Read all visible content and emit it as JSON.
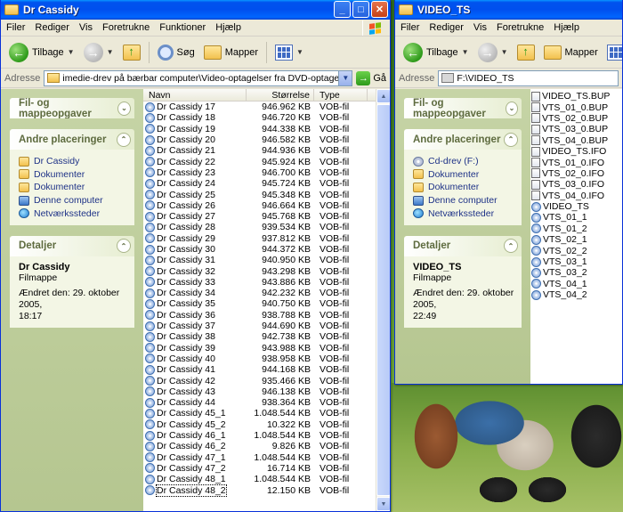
{
  "window1": {
    "title": "Dr Cassidy",
    "menu": [
      "Filer",
      "Rediger",
      "Vis",
      "Foretrukne",
      "Funktioner",
      "Hjælp"
    ],
    "toolbar": {
      "back": "Tilbage",
      "search": "Søg",
      "folders": "Mapper"
    },
    "address": {
      "label": "Adresse",
      "path": "imedie-drev på bærbar computer\\Video-optagelser fra DVD-optagere\\Dr Cassidy\\Dr Cassidy",
      "go": "Gå"
    },
    "tasks": {
      "file_tasks": "Fil- og mappeopgaver",
      "other_places": "Andre placeringer",
      "other_items": [
        "Dr Cassidy",
        "Dokumenter",
        "Dokumenter",
        "Denne computer",
        "Netværkssteder"
      ],
      "details": "Detaljer",
      "detail_name": "Dr Cassidy",
      "detail_type": "Filmappe",
      "detail_modified_1": "Ændret den: 29. oktober 2005,",
      "detail_modified_2": "18:17"
    },
    "columns": {
      "name": "Navn",
      "size": "Størrelse",
      "type": "Type"
    },
    "files": [
      {
        "name": "Dr Cassidy 17",
        "size": "946.962 KB",
        "type": "VOB-fil"
      },
      {
        "name": "Dr Cassidy 18",
        "size": "946.720 KB",
        "type": "VOB-fil"
      },
      {
        "name": "Dr Cassidy 19",
        "size": "944.338 KB",
        "type": "VOB-fil"
      },
      {
        "name": "Dr Cassidy 20",
        "size": "946.582 KB",
        "type": "VOB-fil"
      },
      {
        "name": "Dr Cassidy 21",
        "size": "944.936 KB",
        "type": "VOB-fil"
      },
      {
        "name": "Dr Cassidy 22",
        "size": "945.924 KB",
        "type": "VOB-fil"
      },
      {
        "name": "Dr Cassidy 23",
        "size": "946.700 KB",
        "type": "VOB-fil"
      },
      {
        "name": "Dr Cassidy 24",
        "size": "945.724 KB",
        "type": "VOB-fil"
      },
      {
        "name": "Dr Cassidy 25",
        "size": "945.348 KB",
        "type": "VOB-fil"
      },
      {
        "name": "Dr Cassidy 26",
        "size": "946.664 KB",
        "type": "VOB-fil"
      },
      {
        "name": "Dr Cassidy 27",
        "size": "945.768 KB",
        "type": "VOB-fil"
      },
      {
        "name": "Dr Cassidy 28",
        "size": "939.534 KB",
        "type": "VOB-fil"
      },
      {
        "name": "Dr Cassidy 29",
        "size": "937.812 KB",
        "type": "VOB-fil"
      },
      {
        "name": "Dr Cassidy 30",
        "size": "944.372 KB",
        "type": "VOB-fil"
      },
      {
        "name": "Dr Cassidy 31",
        "size": "940.950 KB",
        "type": "VOB-fil"
      },
      {
        "name": "Dr Cassidy 32",
        "size": "943.298 KB",
        "type": "VOB-fil"
      },
      {
        "name": "Dr Cassidy 33",
        "size": "943.886 KB",
        "type": "VOB-fil"
      },
      {
        "name": "Dr Cassidy 34",
        "size": "942.232 KB",
        "type": "VOB-fil"
      },
      {
        "name": "Dr Cassidy 35",
        "size": "940.750 KB",
        "type": "VOB-fil"
      },
      {
        "name": "Dr Cassidy 36",
        "size": "938.788 KB",
        "type": "VOB-fil"
      },
      {
        "name": "Dr Cassidy 37",
        "size": "944.690 KB",
        "type": "VOB-fil"
      },
      {
        "name": "Dr Cassidy 38",
        "size": "942.738 KB",
        "type": "VOB-fil"
      },
      {
        "name": "Dr Cassidy 39",
        "size": "943.988 KB",
        "type": "VOB-fil"
      },
      {
        "name": "Dr Cassidy 40",
        "size": "938.958 KB",
        "type": "VOB-fil"
      },
      {
        "name": "Dr Cassidy 41",
        "size": "944.168 KB",
        "type": "VOB-fil"
      },
      {
        "name": "Dr Cassidy 42",
        "size": "935.466 KB",
        "type": "VOB-fil"
      },
      {
        "name": "Dr Cassidy 43",
        "size": "946.138 KB",
        "type": "VOB-fil"
      },
      {
        "name": "Dr Cassidy 44",
        "size": "938.364 KB",
        "type": "VOB-fil"
      },
      {
        "name": "Dr Cassidy 45_1",
        "size": "1.048.544 KB",
        "type": "VOB-fil"
      },
      {
        "name": "Dr Cassidy 45_2",
        "size": "10.322 KB",
        "type": "VOB-fil"
      },
      {
        "name": "Dr Cassidy 46_1",
        "size": "1.048.544 KB",
        "type": "VOB-fil"
      },
      {
        "name": "Dr Cassidy 46_2",
        "size": "9.826 KB",
        "type": "VOB-fil"
      },
      {
        "name": "Dr Cassidy 47_1",
        "size": "1.048.544 KB",
        "type": "VOB-fil"
      },
      {
        "name": "Dr Cassidy 47_2",
        "size": "16.714 KB",
        "type": "VOB-fil"
      },
      {
        "name": "Dr Cassidy 48_1",
        "size": "1.048.544 KB",
        "type": "VOB-fil"
      },
      {
        "name": "Dr Cassidy 48_2",
        "size": "12.150 KB",
        "type": "VOB-fil"
      }
    ]
  },
  "window2": {
    "title": "VIDEO_TS",
    "menu": [
      "Filer",
      "Rediger",
      "Vis",
      "Foretrukne",
      "Hjælp"
    ],
    "toolbar": {
      "back": "Tilbage",
      "folders": "Mapper"
    },
    "address": {
      "label": "Adresse",
      "path": "F:\\VIDEO_TS"
    },
    "tasks": {
      "file_tasks": "Fil- og mappeopgaver",
      "other_places": "Andre placeringer",
      "other_items": [
        "Cd-drev (F:)",
        "Dokumenter",
        "Dokumenter",
        "Denne computer",
        "Netværkssteder"
      ],
      "details": "Detaljer",
      "detail_name": "VIDEO_TS",
      "detail_type": "Filmappe",
      "detail_modified_1": "Ændret den: 29. oktober 2005,",
      "detail_modified_2": "22:49"
    },
    "files": [
      "VIDEO_TS.BUP",
      "VTS_01_0.BUP",
      "VTS_02_0.BUP",
      "VTS_03_0.BUP",
      "VTS_04_0.BUP",
      "VIDEO_TS.IFO",
      "VTS_01_0.IFO",
      "VTS_02_0.IFO",
      "VTS_03_0.IFO",
      "VTS_04_0.IFO",
      "VIDEO_TS",
      "VTS_01_1",
      "VTS_01_2",
      "VTS_02_1",
      "VTS_02_2",
      "VTS_03_1",
      "VTS_03_2",
      "VTS_04_1",
      "VTS_04_2"
    ]
  },
  "colors": {
    "title_blue": "#0053ee",
    "task_pane": "#c6d4a6",
    "link_blue": "#1e3287"
  }
}
